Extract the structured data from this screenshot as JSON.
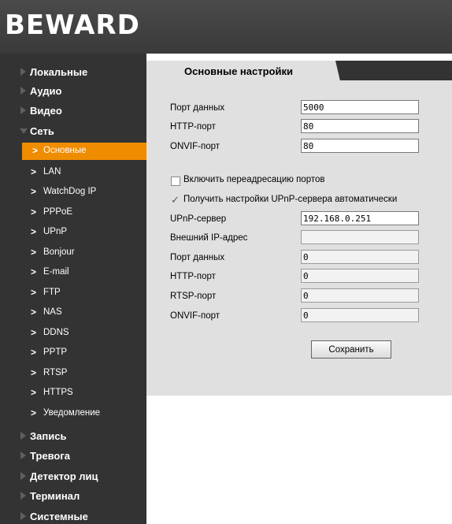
{
  "logo": "BEWARD",
  "sidebar": {
    "top": {
      "local": "Локальные",
      "audio": "Аудио",
      "video": "Видео",
      "network": "Сеть",
      "record": "Запись",
      "alarm": "Тревога",
      "face": "Детектор лиц",
      "terminal": "Терминал",
      "system": "Системные"
    },
    "sub": [
      "Основные",
      "LAN",
      "WatchDog IP",
      "PPPoE",
      "UPnP",
      "Bonjour",
      "E-mail",
      "FTP",
      "NAS",
      "DDNS",
      "PPTP",
      "RTSP",
      "HTTPS",
      "Уведомление"
    ],
    "chevron": ">",
    "active_item": "Основные"
  },
  "tab": {
    "label": "Основные настройки"
  },
  "form": {
    "data_port_label": "Порт данных",
    "data_port_value": "5000",
    "http_port_label": "HTTP-порт",
    "http_port_value": "80",
    "onvif_port_label": "ONVIF-порт",
    "onvif_port_value": "80",
    "port_forward_label": "Включить переадресацию портов",
    "port_forward_checked": false,
    "upnp_auto_label": "Получить настройки UPnP-сервера автоматически",
    "upnp_auto_checked": true,
    "checkmark": "✓",
    "upnp_server_label": "UPnP-сервер",
    "upnp_server_value": "192.168.0.251",
    "external_ip_label": "Внешний IP-адрес",
    "external_ip_value": "",
    "ext_data_port_label": "Порт данных",
    "ext_data_port_value": "0",
    "ext_http_port_label": "HTTP-порт",
    "ext_http_port_value": "0",
    "ext_rtsp_port_label": "RTSP-порт",
    "ext_rtsp_port_value": "0",
    "ext_onvif_port_label": "ONVIF-порт",
    "ext_onvif_port_value": "0",
    "save_label": "Сохранить"
  },
  "colors": {
    "accent": "#f08c00",
    "sidebar_bg": "#333333",
    "content_bg": "#e0e0e0"
  }
}
